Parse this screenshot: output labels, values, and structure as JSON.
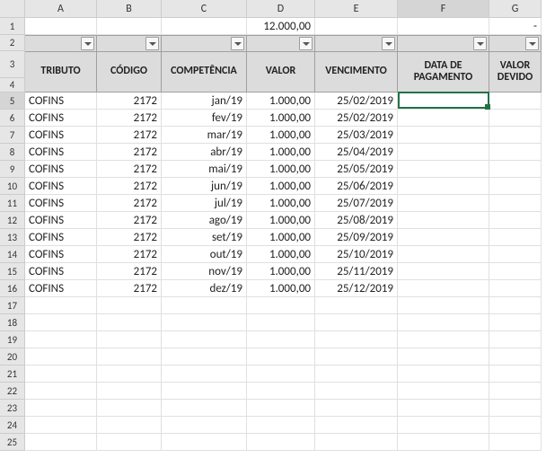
{
  "column_letters": [
    "A",
    "B",
    "C",
    "D",
    "E",
    "F",
    "G"
  ],
  "row_labels": [
    "1",
    "2",
    "3",
    "4",
    "5",
    "6",
    "7",
    "8",
    "9",
    "10",
    "11",
    "12",
    "13",
    "14",
    "15",
    "16",
    "17",
    "18",
    "19",
    "20",
    "21",
    "22",
    "23",
    "24",
    "25"
  ],
  "row1": {
    "D": "12.000,00",
    "G": "-"
  },
  "headers": {
    "A": "TRIBUTO",
    "B": "CÓDIGO",
    "C": "COMPETÊNCIA",
    "D": "VALOR",
    "E": "VENCIMENTO",
    "F": "DATA DE PAGAMENTO",
    "G": "VALOR DEVIDO"
  },
  "data_rows": [
    {
      "tributo": "COFINS",
      "codigo": "2172",
      "comp": "jan/19",
      "valor": "1.000,00",
      "venc": "25/02/2019"
    },
    {
      "tributo": "COFINS",
      "codigo": "2172",
      "comp": "fev/19",
      "valor": "1.000,00",
      "venc": "25/02/2019"
    },
    {
      "tributo": "COFINS",
      "codigo": "2172",
      "comp": "mar/19",
      "valor": "1.000,00",
      "venc": "25/03/2019"
    },
    {
      "tributo": "COFINS",
      "codigo": "2172",
      "comp": "abr/19",
      "valor": "1.000,00",
      "venc": "25/04/2019"
    },
    {
      "tributo": "COFINS",
      "codigo": "2172",
      "comp": "mai/19",
      "valor": "1.000,00",
      "venc": "25/05/2019"
    },
    {
      "tributo": "COFINS",
      "codigo": "2172",
      "comp": "jun/19",
      "valor": "1.000,00",
      "venc": "25/06/2019"
    },
    {
      "tributo": "COFINS",
      "codigo": "2172",
      "comp": "jul/19",
      "valor": "1.000,00",
      "venc": "25/07/2019"
    },
    {
      "tributo": "COFINS",
      "codigo": "2172",
      "comp": "ago/19",
      "valor": "1.000,00",
      "venc": "25/08/2019"
    },
    {
      "tributo": "COFINS",
      "codigo": "2172",
      "comp": "set/19",
      "valor": "1.000,00",
      "venc": "25/09/2019"
    },
    {
      "tributo": "COFINS",
      "codigo": "2172",
      "comp": "out/19",
      "valor": "1.000,00",
      "venc": "25/10/2019"
    },
    {
      "tributo": "COFINS",
      "codigo": "2172",
      "comp": "nov/19",
      "valor": "1.000,00",
      "venc": "25/11/2019"
    },
    {
      "tributo": "COFINS",
      "codigo": "2172",
      "comp": "dez/19",
      "valor": "1.000,00",
      "venc": "25/12/2019"
    }
  ],
  "selected_column": "F",
  "selected_row": 5
}
